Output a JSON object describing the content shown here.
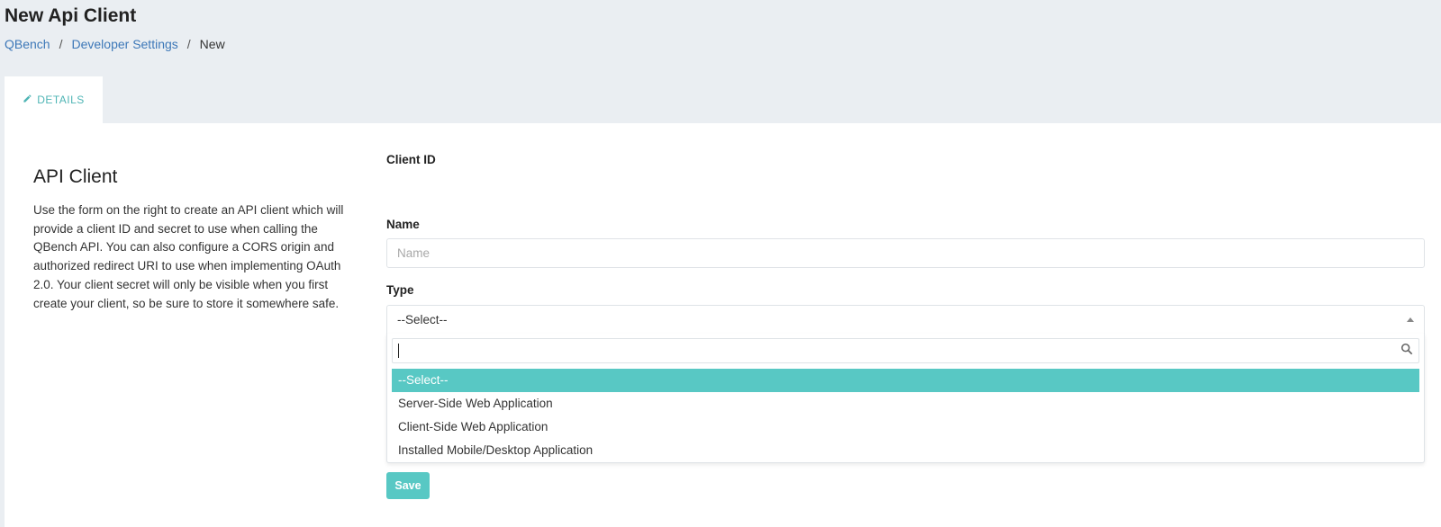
{
  "header": {
    "title": "New Api Client",
    "breadcrumb": {
      "items": [
        "QBench",
        "Developer Settings",
        "New"
      ],
      "separator": "/"
    }
  },
  "tabs": [
    {
      "label": "DETAILS",
      "icon": "pencil-icon",
      "active": true
    }
  ],
  "intro": {
    "title": "API Client",
    "text": "Use the form on the right to create an API client which will provide a client ID and secret to use when calling the QBench API. You can also configure a CORS origin and authorized redirect URI to use when implementing OAuth 2.0. Your client secret will only be visible when you first create your client, so be sure to store it somewhere safe."
  },
  "form": {
    "client_id_label": "Client ID",
    "name_label": "Name",
    "name_placeholder": "Name",
    "name_value": "",
    "type_label": "Type",
    "type_selected": "--Select--",
    "type_options": [
      "--Select--",
      "Server-Side Web Application",
      "Client-Side Web Application",
      "Installed Mobile/Desktop Application"
    ],
    "save_label": "Save"
  },
  "colors": {
    "accent": "#58c8c4",
    "link": "#3d78b8",
    "background": "#eaeef2"
  }
}
